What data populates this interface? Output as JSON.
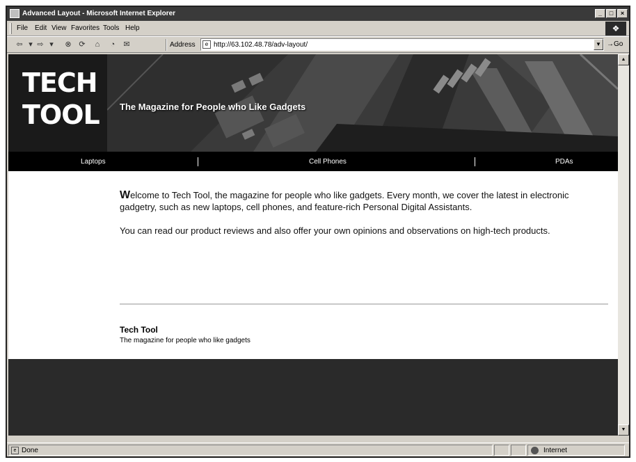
{
  "window": {
    "title": "Advanced Layout - Microsoft Internet Explorer",
    "buttons": [
      "_",
      "□",
      "×"
    ]
  },
  "menubar": {
    "items": [
      "File",
      "Edit",
      "View",
      "Favorites",
      "Tools",
      "Help"
    ]
  },
  "toolbar": {
    "address_label": "Address",
    "address_value": "http://63.102.48.78/adv-layout/",
    "go_label": "Go"
  },
  "page": {
    "logo": {
      "line1": "TECH",
      "line2": "TOOL"
    },
    "tagline": "The Magazine for People who Like Gadgets",
    "nav": [
      "Laptops",
      "Cell Phones",
      "PDAs"
    ],
    "intro_dropcap": "W",
    "intro_rest": "elcome to Tech Tool, the magazine for people who like gadgets. Every month, we cover the latest in electronic gadgetry, such as new laptops, cell phones, and feature-rich Personal Digital Assistants.",
    "paragraph2": "You can read our product reviews and also offer your own opinions and observations on high-tech products.",
    "footer_title": "Tech Tool",
    "footer_subtitle": "The magazine for people who like gadgets"
  },
  "statusbar": {
    "status": "Done",
    "zone": "Internet"
  },
  "colors": {
    "banner_bg": "#2b2b2b",
    "nav_bg": "#000000",
    "footer_bg": "#2a2a2a"
  }
}
